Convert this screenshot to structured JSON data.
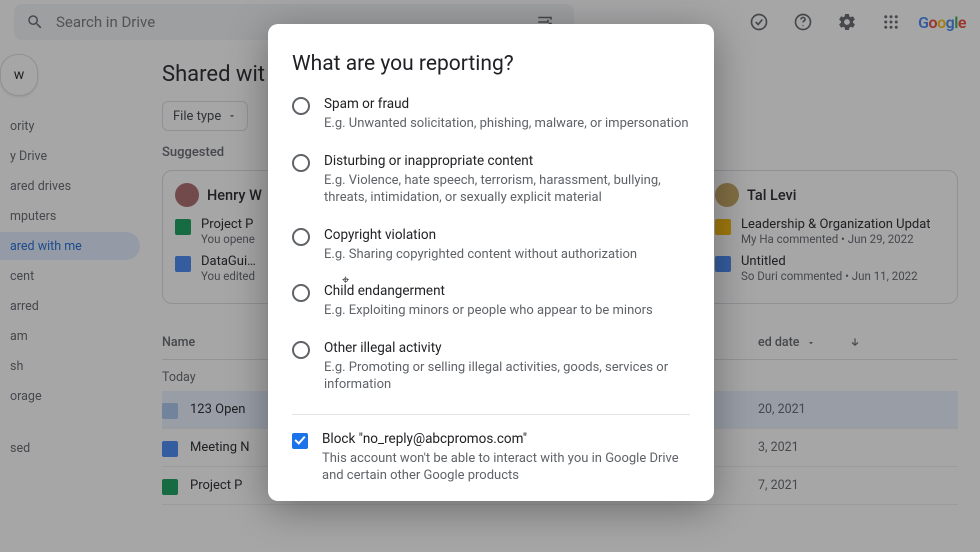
{
  "topbar": {
    "search_placeholder": "Search in Drive",
    "logo": {
      "g1": "G",
      "o1": "o",
      "o2": "o",
      "g2": "g",
      "l": "l",
      "e": "e"
    }
  },
  "sidebar": {
    "new_label": "w",
    "items": [
      {
        "label": "ority"
      },
      {
        "label": "y Drive"
      },
      {
        "label": "ared drives"
      },
      {
        "label": "mputers"
      },
      {
        "label": "ared with me"
      },
      {
        "label": "cent"
      },
      {
        "label": "arred"
      },
      {
        "label": "am"
      },
      {
        "label": "sh"
      },
      {
        "label": "orage"
      },
      {
        "label": "sed"
      }
    ]
  },
  "content": {
    "page_title": "Shared wit",
    "chip_file_type": "File type",
    "suggested_label": "Suggested",
    "cards": [
      {
        "person": "Henry W",
        "files": [
          {
            "title": "Project P",
            "sub": "You opene",
            "icon": "sheet"
          },
          {
            "title": "DataGui…",
            "sub": "You edited",
            "icon": "doc"
          }
        ]
      },
      {
        "person": "Tal Levi",
        "files": [
          {
            "title": "Leadership & Organization Updat",
            "sub": "My Ha commented • Jun 29, 2022",
            "icon": "slide"
          },
          {
            "title": "Untitled",
            "sub": "So Duri commented • Jun 11, 2022",
            "icon": "doc"
          }
        ]
      }
    ],
    "table": {
      "name_header": "Name",
      "date_header": "ed date",
      "group": "Today",
      "rows": [
        {
          "name": "123 Open",
          "date": "20, 2021",
          "icon": "word",
          "selected": true
        },
        {
          "name": "Meeting N",
          "date": "3, 2021",
          "icon": "doc",
          "selected": false
        },
        {
          "name": "Project P",
          "date": "7, 2021",
          "icon": "sheet",
          "selected": false
        }
      ]
    }
  },
  "modal": {
    "title": "What are you reporting?",
    "options": [
      {
        "title": "Spam or fraud",
        "desc": "E.g. Unwanted solicitation, phishing, malware, or impersonation"
      },
      {
        "title": "Disturbing or inappropriate content",
        "desc": "E.g. Violence, hate speech, terrorism, harassment, bullying, threats, intimidation, or sexually explicit material"
      },
      {
        "title": "Copyright violation",
        "desc": "E.g. Sharing copyrighted content without authorization"
      },
      {
        "title": "Child endangerment",
        "desc": "E.g. Exploiting minors or people who appear to be minors"
      },
      {
        "title": "Other illegal activity",
        "desc": "E.g. Promoting or selling illegal activities, goods, services or information"
      }
    ],
    "block": {
      "title": "Block \"no_reply@abcpromos.com\"",
      "desc": "This account won't be able to interact with you in Google Drive and certain other Google products"
    }
  }
}
